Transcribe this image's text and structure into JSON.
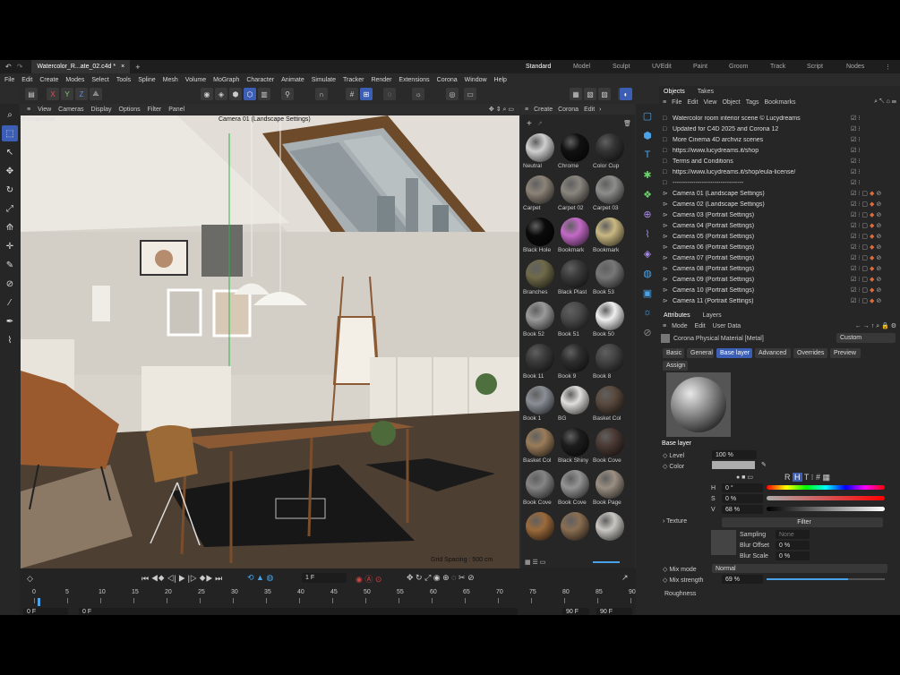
{
  "tabs": {
    "doc": "Watercolor_R...ate_02.c4d *",
    "add": "+"
  },
  "workspaces": [
    "Standard",
    "Model",
    "Sculpt",
    "UVEdit",
    "Paint",
    "Groom",
    "Track",
    "Script",
    "Nodes"
  ],
  "menu": [
    "File",
    "Edit",
    "Create",
    "Modes",
    "Select",
    "Tools",
    "Spline",
    "Mesh",
    "Volume",
    "MoGraph",
    "Character",
    "Animate",
    "Simulate",
    "Tracker",
    "Render",
    "Extensions",
    "Corona",
    "Window",
    "Help"
  ],
  "viewport": {
    "menu": [
      "View",
      "Cameras",
      "Display",
      "Options",
      "Filter",
      "Panel"
    ],
    "label": "Perspective",
    "camera": "Camera 01 (Landscape Settings)",
    "grid": "Grid Spacing : 500 cm"
  },
  "matbar": {
    "create": "Create",
    "corona": "Corona",
    "edit": "Edit"
  },
  "materials": [
    "Neutral",
    "Chrome",
    "Color Cup",
    "Carpet",
    "Carpet 02",
    "Carpet 03",
    "Black Hole",
    "Bookmark",
    "Bookmark",
    "Branches",
    "Black Plast",
    "Book 53",
    "Book 52",
    "Book 51",
    "Book 50",
    "Book 11",
    "Book 9",
    "Book 8",
    "Book 1",
    "BG",
    "Basket Col",
    "Basket Col",
    "Black Shiny",
    "Book Cove",
    "Book Cove",
    "Book Cove",
    "Book Page",
    "",
    "",
    ""
  ],
  "objects": {
    "tab1": "Objects",
    "tab2": "Takes",
    "menu": [
      "File",
      "Edit",
      "View",
      "Object",
      "Tags",
      "Bookmarks"
    ],
    "rows": [
      "Watercolor room interior scene © Lucydreams",
      "Updated for C4D 2025 and Corona 12",
      "More Cinema 4D archviz scenes",
      "https://www.lucydreams.it/shop",
      "Terms and Conditions",
      "https://www.lucydreams.it/shop/eula-license/",
      "----------------------------------",
      "Camera 01 (Landscape Settings)",
      "Camera 02 (Landscape Settings)",
      "Camera 03 (Portrait Settings)",
      "Camera 04 (Portrait Settings)",
      "Camera 05 (Portrait Settings)",
      "Camera 06 (Portrait Settings)",
      "Camera 07 (Portrait Settings)",
      "Camera 08 (Portrait Settings)",
      "Camera 09 (Portrait Settings)",
      "Camera 10 (Portrait Settings)",
      "Camera 11 (Portrait Settings)"
    ]
  },
  "attributes": {
    "tab1": "Attributes",
    "tab2": "Layers",
    "menu": [
      "Mode",
      "Edit",
      "User Data"
    ],
    "material": "Corona Physical Material [Metal]",
    "preset": "Custom",
    "subtabs": [
      "Basic",
      "General",
      "Base layer",
      "Advanced",
      "Overrides",
      "Preview"
    ],
    "assign": "Assign",
    "section": "Base layer",
    "level_label": "Level",
    "level": "100 %",
    "color_label": "Color",
    "h_label": "H",
    "h": "0 °",
    "s_label": "S",
    "s": "0 %",
    "v_label": "V",
    "v": "68 %",
    "texture": "Texture",
    "filter": "Filter",
    "sampling": "Sampling",
    "sampling_val": "None",
    "blur_offset": "Blur Offset",
    "blur_offset_val": "0 %",
    "blur_scale": "Blur Scale",
    "blur_scale_val": "0 %",
    "mix_mode": "Mix mode",
    "mix_mode_val": "Normal",
    "mix_strength": "Mix strength",
    "mix_strength_val": "69 %",
    "roughness": "Roughness"
  },
  "timeline": {
    "ticks": [
      "0",
      "5",
      "10",
      "15",
      "20",
      "25",
      "30",
      "35",
      "40",
      "45",
      "50",
      "55",
      "60",
      "65",
      "70",
      "75",
      "80",
      "85",
      "90"
    ],
    "frame": "1 F",
    "start": "0 F",
    "cur": "0 F",
    "end1": "90 F",
    "end2": "90 F"
  },
  "colors": {
    "accent": "#3c5fb5",
    "highlight": "#4aa3e8"
  }
}
